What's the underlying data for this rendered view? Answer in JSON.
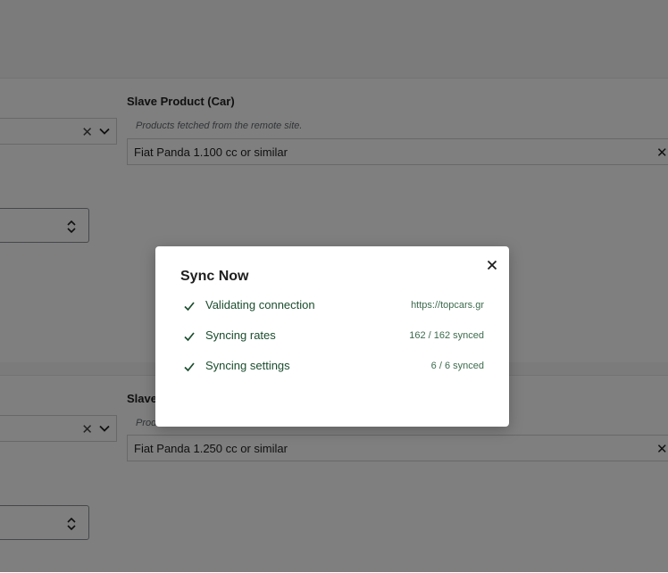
{
  "section_one": {
    "slave_label": "Slave Product (Car)",
    "hint": "Products fetched from the remote site.",
    "product_value": "Fiat Panda 1.100 cc or similar",
    "clear_glyph": "✕"
  },
  "section_two": {
    "slave_label": "Slave Product (Car)",
    "hint": "Products fetched from the remote site.",
    "product_value": "Fiat Panda 1.250 cc or similar",
    "clear_glyph": "✕"
  },
  "modal": {
    "title": "Sync Now",
    "close_icon": "close-icon",
    "steps": [
      {
        "label": "Validating connection",
        "detail": "https://topcars.gr",
        "status": "done"
      },
      {
        "label": "Syncing rates",
        "detail": "162 / 162 synced",
        "status": "done"
      },
      {
        "label": "Syncing settings",
        "detail": "6 / 6 synced",
        "status": "done"
      }
    ]
  },
  "colors": {
    "success_text": "#1a4d2e",
    "overlay": "rgba(0,0,0,0.5)"
  }
}
